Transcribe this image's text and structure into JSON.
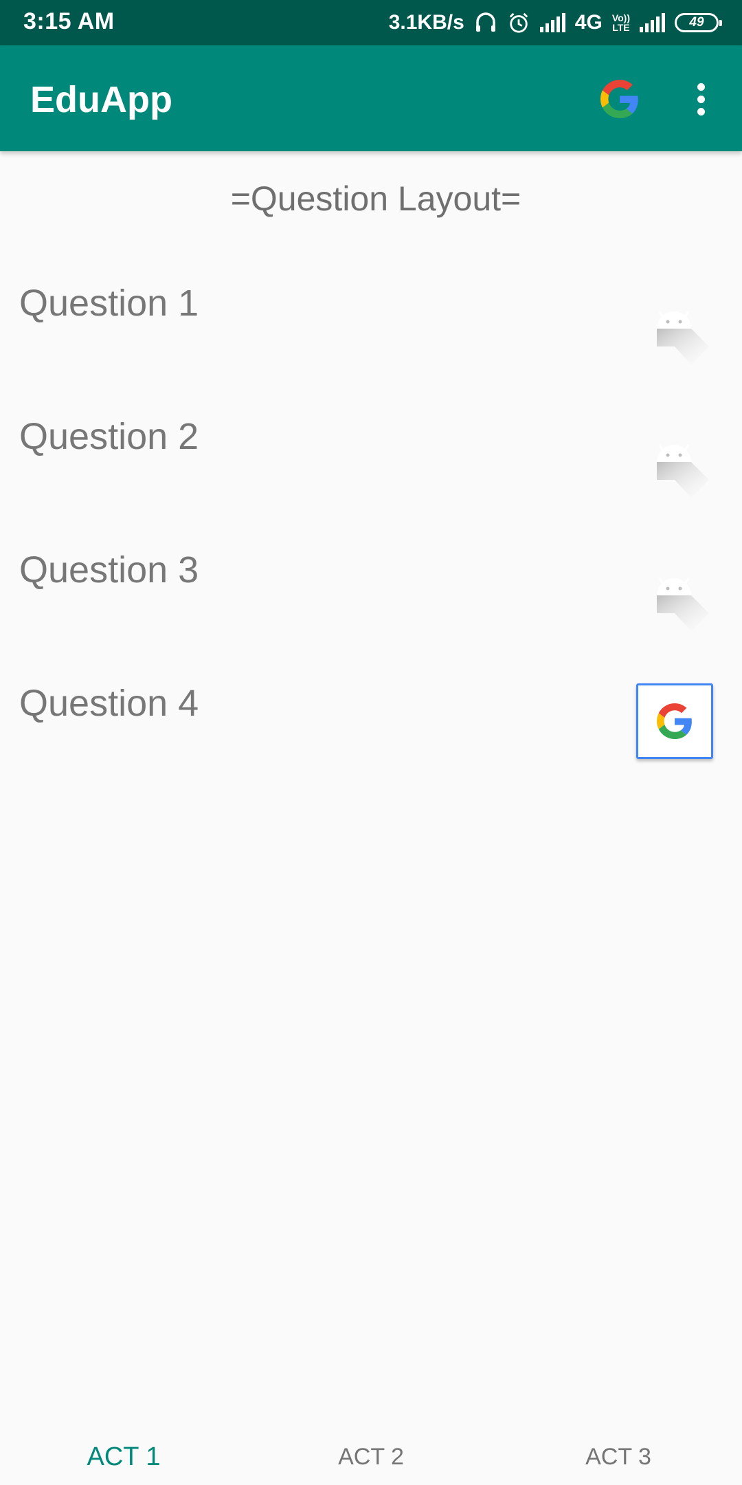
{
  "status_bar": {
    "time": "3:15 AM",
    "network_speed": "3.1KB/s",
    "network_type": "4G",
    "volte_top": "Vo))",
    "volte_bottom": "LTE",
    "battery": "49",
    "icons": [
      "headphones-icon",
      "alarm-icon",
      "signal-icon",
      "volte-icon",
      "signal-icon",
      "battery-icon"
    ]
  },
  "app_bar": {
    "title": "EduApp",
    "icons": [
      "google-icon",
      "overflow-menu-icon"
    ]
  },
  "content": {
    "header": "=Question Layout=",
    "questions": [
      {
        "label": "Question 1",
        "icon": "android-icon"
      },
      {
        "label": "Question 2",
        "icon": "android-icon"
      },
      {
        "label": "Question 3",
        "icon": "android-icon"
      },
      {
        "label": "Question 4",
        "icon": "google-signin-button"
      }
    ]
  },
  "bottom_tabs": {
    "items": [
      "ACT 1",
      "ACT 2",
      "ACT 3"
    ],
    "active_index": 0
  },
  "colors": {
    "status_bar": "#00574b",
    "app_bar": "#00897b",
    "accent": "#00897b",
    "google_blue": "#4285f4",
    "google_red": "#ea4335",
    "google_yellow": "#fbbc05",
    "google_green": "#34a853"
  }
}
